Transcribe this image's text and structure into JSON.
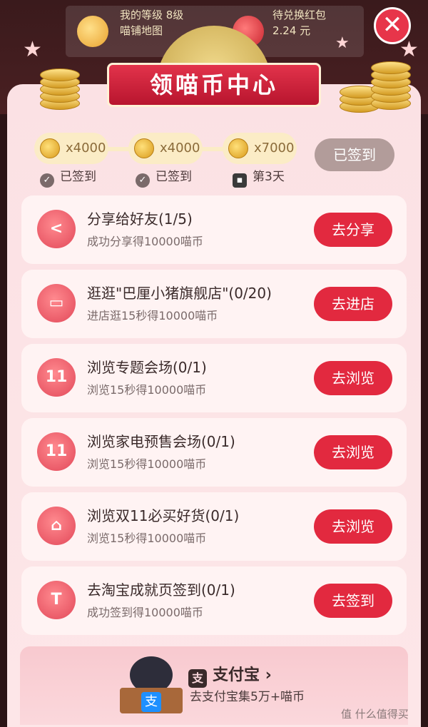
{
  "header": {
    "level_text": "我的等级 8级",
    "map_text": "喵铺地图",
    "redpack_text": "待兑换红包",
    "redpack_amount": "2.24 元",
    "close_symbol": "✕",
    "title": "领喵币中心"
  },
  "checkin": {
    "days": [
      {
        "reward": "x4000",
        "status": "已签到",
        "status_icon": "check-icon"
      },
      {
        "reward": "x4000",
        "status": "已签到",
        "status_icon": "check-icon"
      },
      {
        "reward": "x7000",
        "status": "第3天",
        "status_icon": "lock-icon"
      }
    ],
    "button_label": "已签到"
  },
  "tasks": [
    {
      "icon": "share-icon",
      "glyph": "<",
      "title": "分享给好友(1/5)",
      "subtitle": "成功分享得10000喵币",
      "button": "去分享"
    },
    {
      "icon": "shop-icon",
      "glyph": "▭",
      "title": "逛逛\"巴厘小猪旗舰店\"(0/20)",
      "subtitle": "进店逛15秒得10000喵币",
      "button": "去进店"
    },
    {
      "icon": "double11-icon",
      "glyph": "11",
      "title": "浏览专题会场(0/1)",
      "subtitle": "浏览15秒得10000喵币",
      "button": "去浏览"
    },
    {
      "icon": "double11-icon",
      "glyph": "11",
      "title": "浏览家电预售会场(0/1)",
      "subtitle": "浏览15秒得10000喵币",
      "button": "去浏览"
    },
    {
      "icon": "bag-icon",
      "glyph": "⌂",
      "title": "浏览双11必买好货(0/1)",
      "subtitle": "浏览15秒得10000喵币",
      "button": "去浏览"
    },
    {
      "icon": "shirt-icon",
      "glyph": "T",
      "title": "去淘宝成就页签到(0/1)",
      "subtitle": "成功签到得10000喵币",
      "button": "去签到"
    }
  ],
  "alipay": {
    "logo_mark": "支",
    "logo_text": "支付宝",
    "chevron": "›",
    "description": "去支付宝集5万+喵币",
    "badge": "支"
  },
  "watermark": "值 什么值得买"
}
